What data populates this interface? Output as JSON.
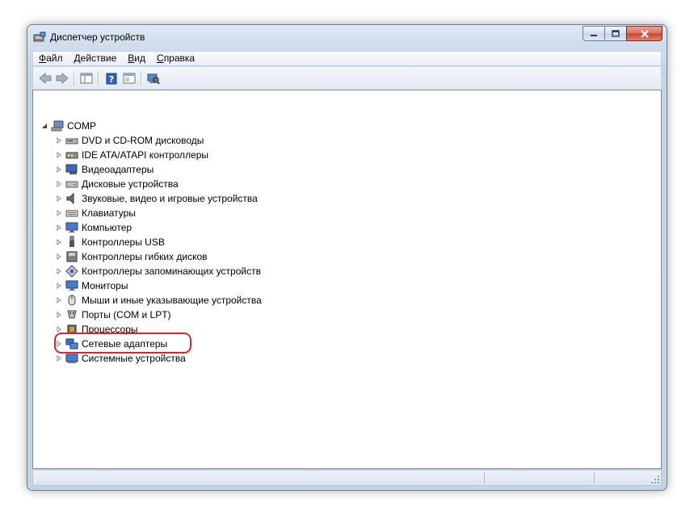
{
  "window": {
    "title": "Диспетчер устройств",
    "icons": {
      "app": "device-manager-icon"
    }
  },
  "menu": {
    "items": [
      {
        "accel": "Ф",
        "rest": "айл"
      },
      {
        "accel": "Д",
        "rest": "ействие"
      },
      {
        "accel": "В",
        "rest": "ид"
      },
      {
        "accel": "С",
        "rest": "правка"
      }
    ]
  },
  "toolbar": {
    "buttons": [
      "back-arrow-icon",
      "forward-arrow-icon",
      "show-hide-tree-icon",
      "help-icon",
      "properties-icon",
      "scan-hardware-icon"
    ]
  },
  "tree": {
    "root": {
      "label": "COMP",
      "icon": "computer-icon",
      "expanded": true
    },
    "items": [
      {
        "label": "DVD и CD-ROM дисководы",
        "icon": "dvd-drive-icon"
      },
      {
        "label": "IDE ATA/ATAPI контроллеры",
        "icon": "ide-controller-icon"
      },
      {
        "label": "Видеоадаптеры",
        "icon": "display-adapter-icon"
      },
      {
        "label": "Дисковые устройства",
        "icon": "disk-drive-icon"
      },
      {
        "label": "Звуковые, видео и игровые устройства",
        "icon": "speaker-icon"
      },
      {
        "label": "Клавиатуры",
        "icon": "keyboard-icon"
      },
      {
        "label": "Компьютер",
        "icon": "monitor-icon"
      },
      {
        "label": "Контроллеры USB",
        "icon": "usb-icon"
      },
      {
        "label": "Контроллеры гибких дисков",
        "icon": "floppy-controller-icon"
      },
      {
        "label": "Контроллеры запоминающих устройств",
        "icon": "storage-controller-icon"
      },
      {
        "label": "Мониторы",
        "icon": "monitor-icon"
      },
      {
        "label": "Мыши и иные указывающие устройства",
        "icon": "mouse-icon"
      },
      {
        "label": "Порты (COM и LPT)",
        "icon": "port-icon"
      },
      {
        "label": "Процессоры",
        "icon": "processor-icon"
      },
      {
        "label": "Сетевые адаптеры",
        "icon": "network-adapter-icon"
      },
      {
        "label": "Системные устройства",
        "icon": "system-device-icon"
      }
    ]
  },
  "highlight": {
    "target": "Сетевые адаптеры",
    "color": "#d22a2a"
  }
}
